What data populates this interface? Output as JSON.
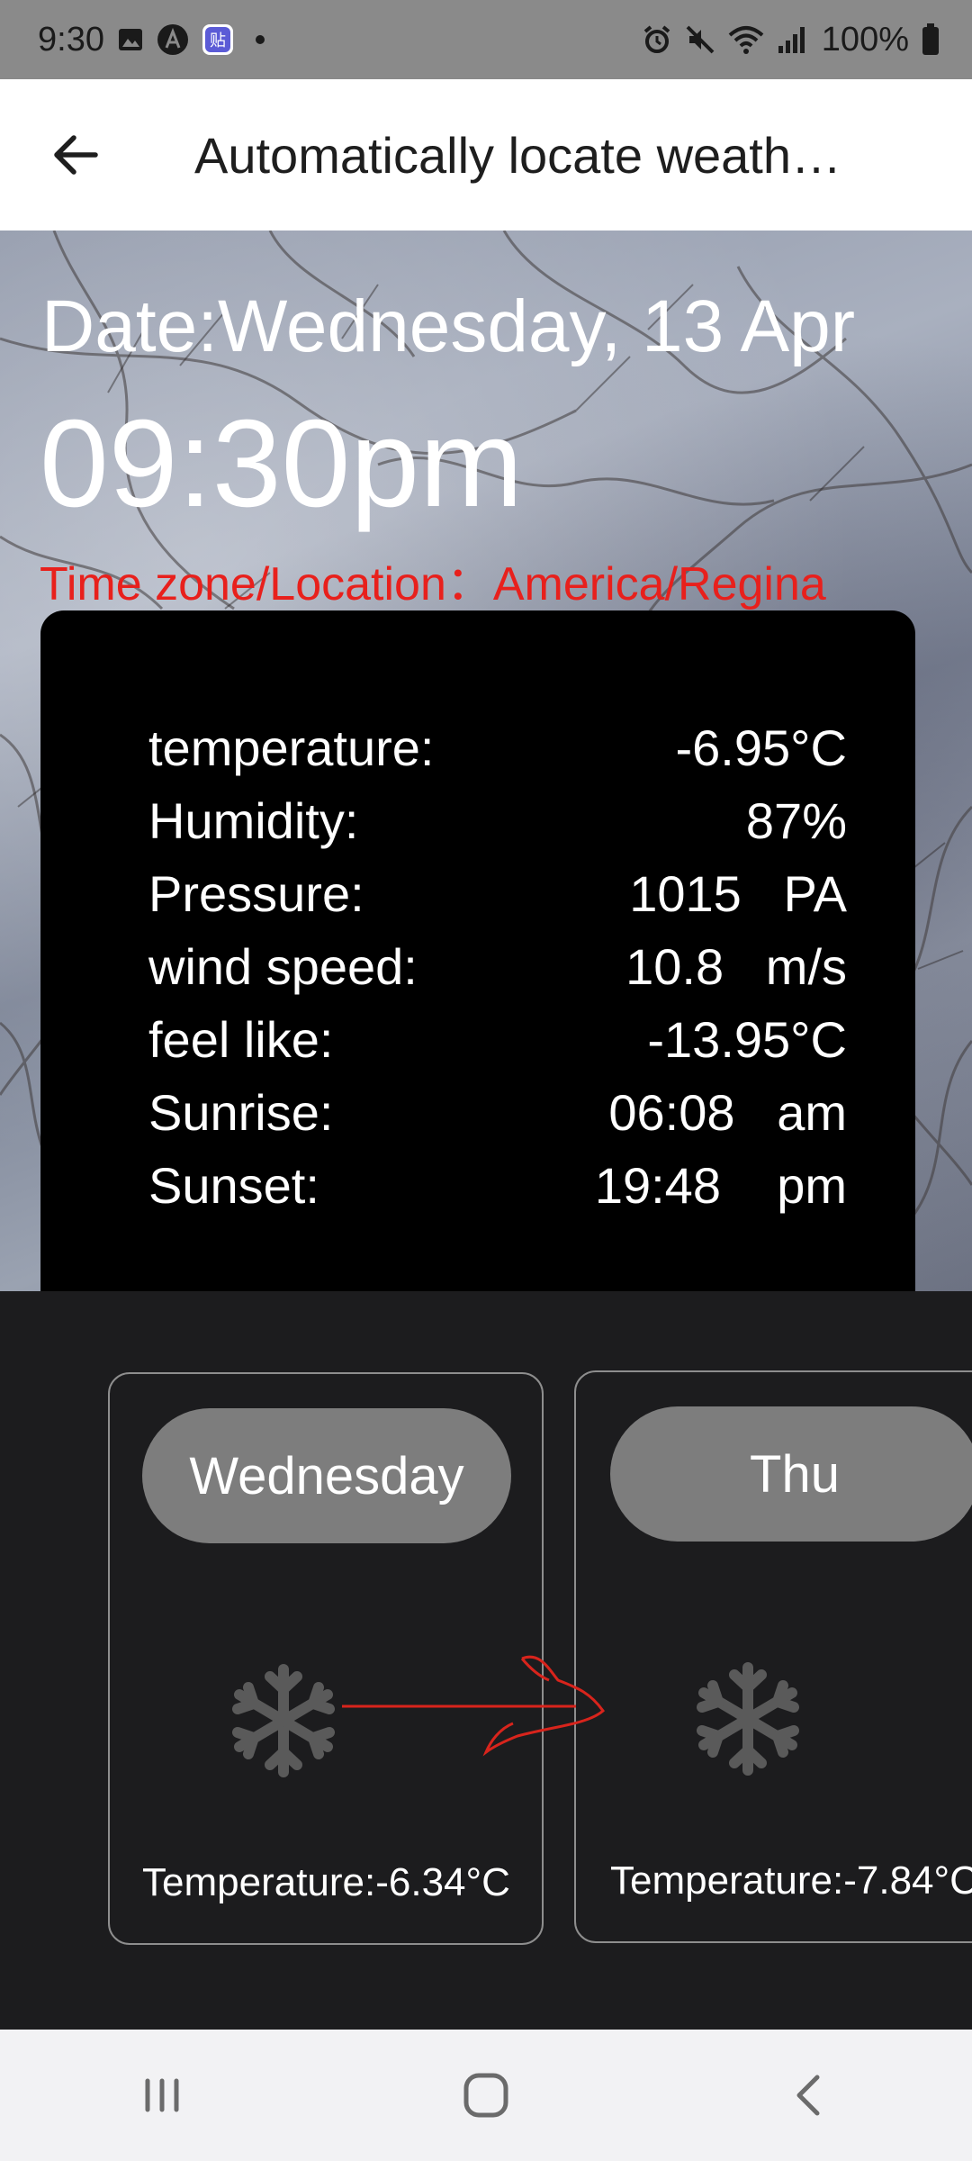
{
  "status_bar": {
    "time": "9:30",
    "battery": "100%",
    "icons_left": [
      "image-icon",
      "a-circle-icon",
      "app-badge-icon",
      "dot-icon"
    ],
    "icons_right": [
      "alarm-icon",
      "mute-icon",
      "wifi-icon",
      "signal-icon",
      "battery-icon"
    ]
  },
  "app_bar": {
    "title": "Automatically locate weath…"
  },
  "hero": {
    "date": "Date:Wednesday, 13 Apr",
    "time": "09:30pm",
    "timezone": "Time zone/Location：America/Regina"
  },
  "details": [
    {
      "label": "temperature:",
      "value": "-6.95°C"
    },
    {
      "label": "Humidity:",
      "value": "87%"
    },
    {
      "label": "Pressure:",
      "value": "1015   PA"
    },
    {
      "label": "wind speed:",
      "value": "10.8   m/s"
    },
    {
      "label": "feel like:",
      "value": "-13.95°C"
    },
    {
      "label": "Sunrise:",
      "value": "06:08   am"
    },
    {
      "label": "Sunset:",
      "value": "19:48    pm"
    }
  ],
  "forecast": [
    {
      "day": "Wednesday",
      "icon": "snowflake-icon",
      "temperature": "Temperature:-6.34°C"
    },
    {
      "day": "Thu",
      "icon": "snowflake-icon",
      "temperature": "Temperature:-7.84°C"
    }
  ],
  "colors": {
    "timezone_text": "#e8201c",
    "card_bg": "#000000",
    "pill_bg": "#7d7d7d",
    "forecast_bg": "#1c1c1e"
  }
}
